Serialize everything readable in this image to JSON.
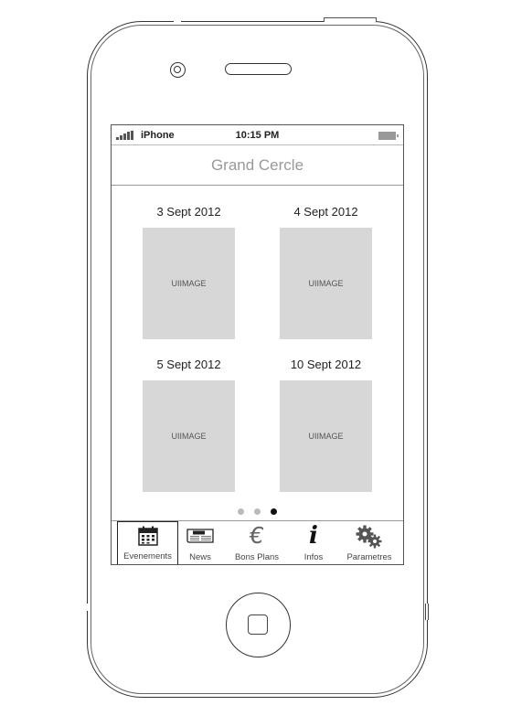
{
  "status_bar": {
    "carrier": "iPhone",
    "time": "10:15 PM"
  },
  "nav": {
    "title": "Grand Cercle"
  },
  "events": [
    {
      "date": "3 Sept 2012",
      "image_label": "UIIMAGE"
    },
    {
      "date": "4 Sept 2012",
      "image_label": "UIIMAGE"
    },
    {
      "date": "5 Sept 2012",
      "image_label": "UIIMAGE"
    },
    {
      "date": "10 Sept 2012",
      "image_label": "UIIMAGE"
    }
  ],
  "page_control": {
    "count": 3,
    "current": 3
  },
  "tabs": [
    {
      "label": "Evenements",
      "icon": "calendar-icon",
      "selected": true
    },
    {
      "label": "News",
      "icon": "newspaper-icon",
      "selected": false
    },
    {
      "label": "Bons Plans",
      "icon": "euro-icon",
      "selected": false
    },
    {
      "label": "Infos",
      "icon": "info-icon",
      "selected": false
    },
    {
      "label": "Parametres",
      "icon": "gears-icon",
      "selected": false
    }
  ]
}
